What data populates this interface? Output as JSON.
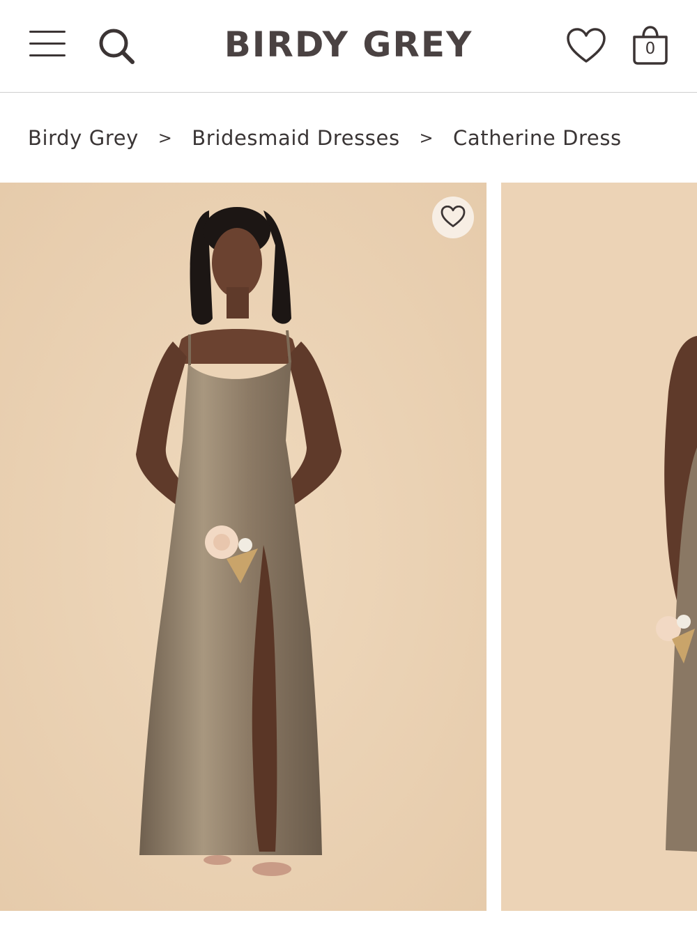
{
  "header": {
    "logo": "BIRDY GREY",
    "menu_icon": "hamburger-menu-icon",
    "search_icon": "search-icon",
    "wishlist_icon": "heart-icon",
    "bag_icon": "shopping-bag-icon",
    "bag_count": "0"
  },
  "breadcrumb": {
    "items": [
      "Birdy Grey",
      "Bridesmaid Dresses",
      "Catherine Dress"
    ],
    "separator": ">"
  },
  "gallery": {
    "favorite_icon": "heart-outline-icon",
    "background_color": "#ecd3b6",
    "dress_color": "#8c7a65"
  }
}
